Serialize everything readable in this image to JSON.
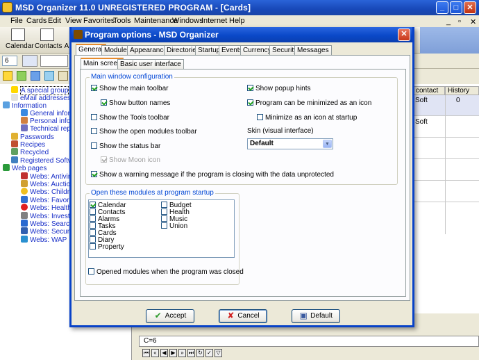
{
  "window": {
    "title": "MSD Organizer 11.0 UNREGISTERED PROGRAM - [Cards]"
  },
  "menu": [
    "File",
    "Cards",
    "Edit",
    "View",
    "Favorites",
    "Tools",
    "Maintenance",
    "Windows",
    "Internet",
    "Help"
  ],
  "toolbar": {
    "calendar": "Calendar",
    "contacts": "Contacts",
    "a": "A",
    "field_value": "6"
  },
  "tree": {
    "items": [
      "A special group",
      "eMail addresses",
      "Information",
      "General informat",
      "Personal informa",
      "Technical report",
      "Passwords",
      "Recipes",
      "Recycled",
      "Registered Software",
      "Web pages",
      "Webs: Antivirus",
      "Webs: Auction",
      "Webs: Children",
      "Webs: Favorites",
      "Webs: Health",
      "Webs: Investment",
      "Webs: Search",
      "Webs: Security",
      "Webs: WAP"
    ]
  },
  "grid": {
    "headers": [
      "contact",
      "History"
    ],
    "rows": [
      [
        "Soft",
        "0"
      ],
      [
        "Soft",
        ""
      ]
    ]
  },
  "status": {
    "text": "C=6"
  },
  "dialog": {
    "title": "Program options - MSD Organizer",
    "tabs": [
      "General",
      "Modules",
      "Appearance",
      "Directories",
      "Startup",
      "Events",
      "Currency",
      "Security",
      "Messages"
    ],
    "subtabs": [
      "Main screen",
      "Basic user interface"
    ],
    "main_group_label": "Main window configuration",
    "checks": {
      "show_main_toolbar": "Show the main toolbar",
      "show_button_names": "Show button names",
      "show_tools_toolbar": "Show the Tools toolbar",
      "show_open_modules_toolbar": "Show the open modules toolbar",
      "show_status_bar": "Show the status bar",
      "show_moon_icon": "Show Moon icon",
      "show_warning": "Show a warning message if the program is closing with the data unprotected",
      "show_popup_hints": "Show popup hints",
      "minimized_as_icon": "Program can be minimized as an icon",
      "minimize_at_startup": "Minimize as an icon at startup"
    },
    "skin_label": "Skin (visual interface)",
    "skin_value": "Default",
    "modules_group_label": "Open these modules at program startup",
    "modules_left": [
      "Calendar",
      "Contacts",
      "Alarms",
      "Tasks",
      "Cards",
      "Diary",
      "Property"
    ],
    "modules_right": [
      "Budget",
      "Health",
      "Music",
      "Union"
    ],
    "opened_modules": "Opened modules when the program was closed",
    "buttons": {
      "accept": "Accept",
      "cancel": "Cancel",
      "default": "Default"
    }
  }
}
